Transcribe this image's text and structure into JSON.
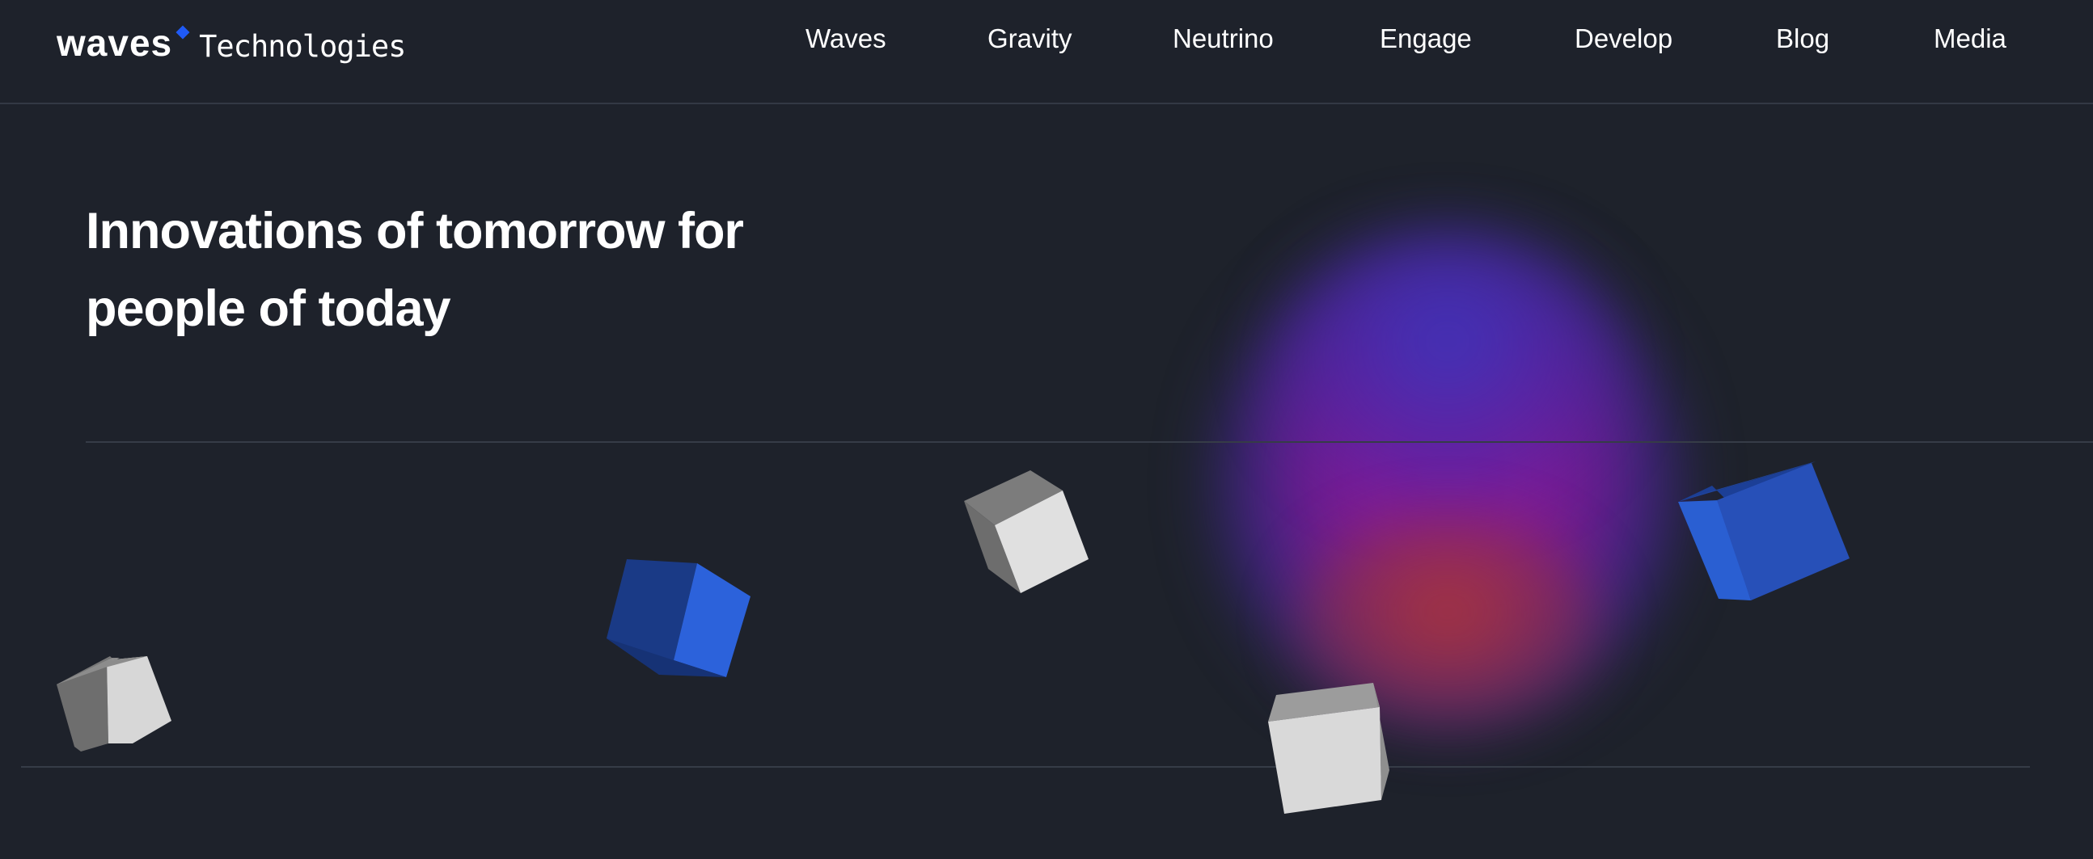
{
  "header": {
    "logo": {
      "wordmark": "waves",
      "subtitle": "Technologies"
    },
    "nav": [
      {
        "label": "Waves"
      },
      {
        "label": "Gravity"
      },
      {
        "label": "Neutrino"
      },
      {
        "label": "Engage"
      },
      {
        "label": "Develop"
      },
      {
        "label": "Blog"
      },
      {
        "label": "Media"
      }
    ]
  },
  "hero": {
    "title_line1": "Innovations of tomorrow for",
    "title_line2": "people of today"
  },
  "colors": {
    "background": "#1e222b",
    "accent": "#1f5af6",
    "cube_gray": "#d8d8d8",
    "cube_blue": "#2a5fd6"
  }
}
